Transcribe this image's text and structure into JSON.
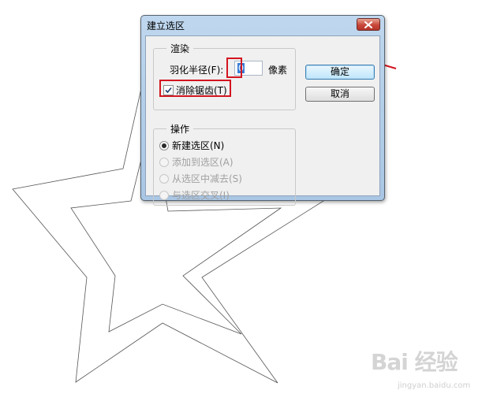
{
  "dialog": {
    "title": "建立选区",
    "render_group": {
      "legend": "渲染",
      "feather_label": "羽化半径(F):",
      "feather_value": "0",
      "feather_unit": "像素",
      "antialias_label": "消除锯齿(T)",
      "antialias_checked": true
    },
    "operation_group": {
      "legend": "操作",
      "options": [
        {
          "label": "新建选区(N)",
          "checked": true,
          "enabled": true
        },
        {
          "label": "添加到选区(A)",
          "checked": false,
          "enabled": false
        },
        {
          "label": "从选区中减去(S)",
          "checked": false,
          "enabled": false
        },
        {
          "label": "与选区交叉(I)",
          "checked": false,
          "enabled": false
        }
      ]
    },
    "ok_label": "确定",
    "cancel_label": "取消"
  },
  "watermark": {
    "text": "Bai 经验",
    "subtext": "jingyan.baidu.com"
  },
  "colors": {
    "highlight": "#d3151f",
    "arrow": "#d3151f"
  }
}
